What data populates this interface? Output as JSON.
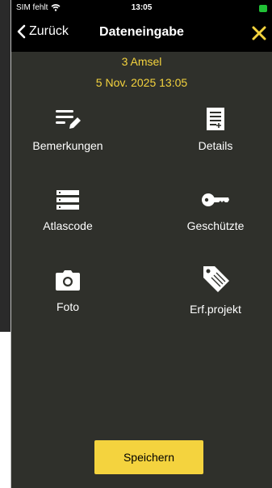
{
  "status_bar": {
    "carrier": "SIM fehlt",
    "time": "13:05"
  },
  "nav": {
    "back_label": "Zurück",
    "title": "Dateneingabe"
  },
  "info": {
    "count_species": "3 Amsel",
    "datetime": "5 Nov. 2025 13:05"
  },
  "grid": {
    "items": [
      {
        "label": "Bemerkungen",
        "icon": "notes-edit-icon"
      },
      {
        "label": "Details",
        "icon": "document-add-icon"
      },
      {
        "label": "Atlascode",
        "icon": "list-stack-icon"
      },
      {
        "label": "Geschützte",
        "icon": "key-icon"
      },
      {
        "label": "Foto",
        "icon": "camera-icon"
      },
      {
        "label": "Erf.projekt",
        "icon": "tag-icon"
      }
    ]
  },
  "actions": {
    "save_label": "Speichern"
  },
  "colors": {
    "background": "#2f302b",
    "accent": "#f4d33e",
    "bars": "#000000",
    "battery": "#21c036"
  }
}
